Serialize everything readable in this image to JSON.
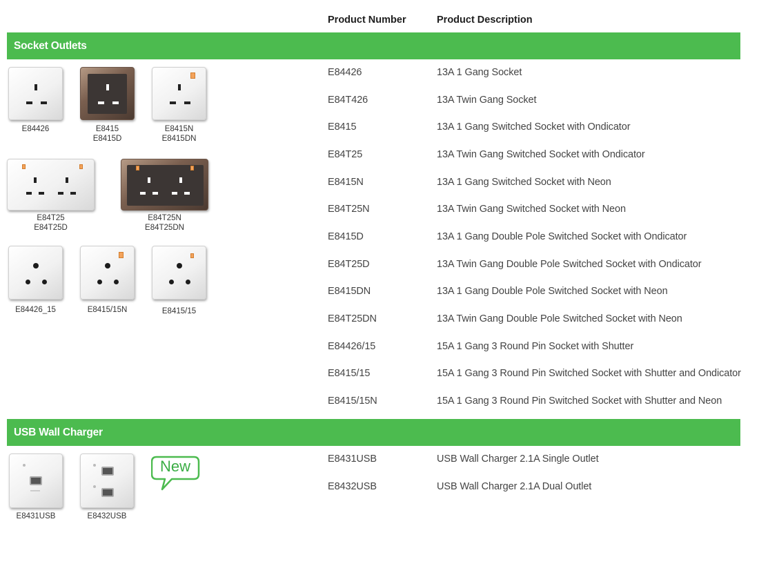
{
  "headers": {
    "product_number": "Product Number",
    "product_description": "Product Description"
  },
  "sections": [
    {
      "title": "Socket Outlets",
      "rows": [
        {
          "code": "E84426",
          "desc": "13A 1 Gang Socket"
        },
        {
          "code": "E84T426",
          "desc": "13A Twin Gang Socket"
        },
        {
          "code": "E8415",
          "desc": "13A 1 Gang Switched Socket with Ondicator"
        },
        {
          "code": "E84T25",
          "desc": "13A Twin Gang Switched Socket with Ondicator"
        },
        {
          "code": "E8415N",
          "desc": "13A 1 Gang Switched Socket with Neon"
        },
        {
          "code": "E84T25N",
          "desc": "13A Twin Gang Switched Socket with Neon"
        },
        {
          "code": "E8415D",
          "desc": "13A 1 Gang Double Pole Switched Socket with Ondicator"
        },
        {
          "code": "E84T25D",
          "desc": "13A Twin Gang Double Pole Switched Socket with Ondicator"
        },
        {
          "code": "E8415DN",
          "desc": "13A 1 Gang Double Pole Switched Socket with Neon"
        },
        {
          "code": "E84T25DN",
          "desc": "13A Twin Gang Double Pole Switched Socket with Neon"
        },
        {
          "code": "E84426/15",
          "desc": "15A 1 Gang 3 Round Pin Socket with Shutter"
        },
        {
          "code": "E8415/15",
          "desc": "15A 1 Gang 3 Round Pin Switched Socket with Shutter and Ondicator"
        },
        {
          "code": "E8415/15N",
          "desc": "15A 1 Gang 3 Round Pin Switched Socket with Shutter and Neon"
        }
      ],
      "image_captions": [
        "E84426",
        "E8415\nE8415D",
        "E8415N\nE8415DN",
        "E84T25\nE84T25D",
        "E84T25N\nE84T25DN",
        "E84426_15",
        "E8415/15N",
        "E8415/15"
      ]
    },
    {
      "title": "USB Wall Charger",
      "rows": [
        {
          "code": "E8431USB",
          "desc": "USB Wall Charger 2.1A Single Outlet"
        },
        {
          "code": "E8432USB",
          "desc": "USB Wall Charger 2.1A Dual Outlet"
        }
      ],
      "image_captions": [
        "E8431USB",
        "E8432USB"
      ],
      "badge": "New"
    }
  ],
  "colors": {
    "section_band": "#4cbb4f",
    "bronze_plate": "#5a463b"
  }
}
